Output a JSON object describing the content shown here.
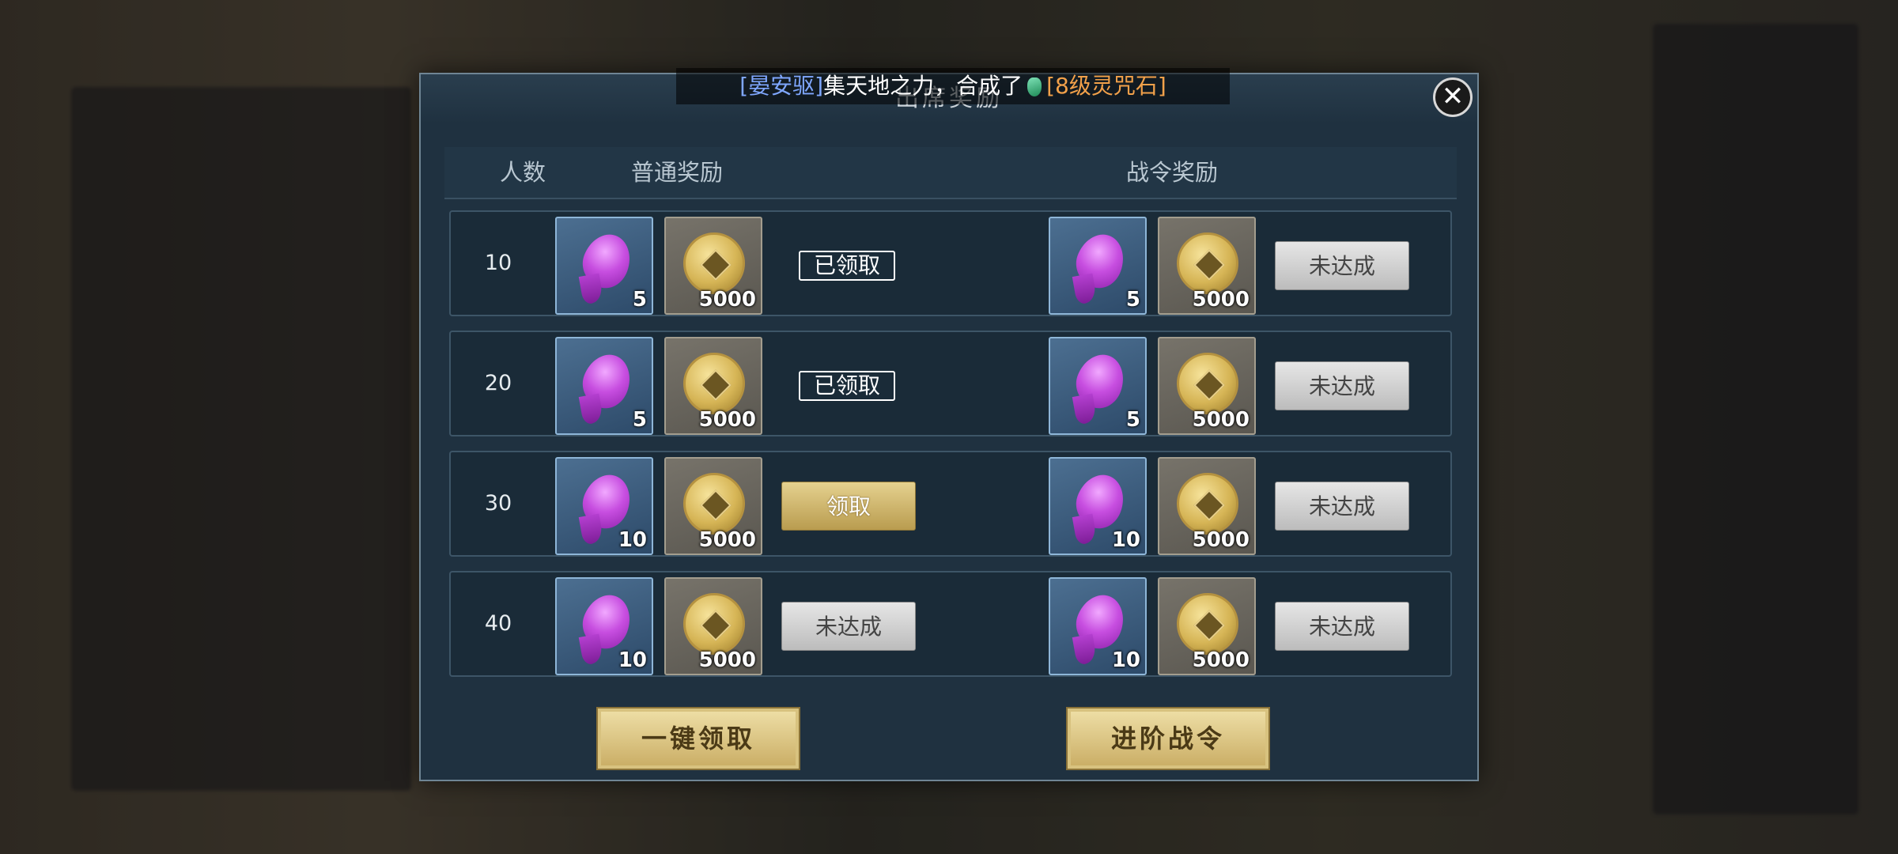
{
  "banner": {
    "player": "[晏安驱]",
    "message": "集天地之力，合成了",
    "item": "[8级灵咒石]"
  },
  "modal": {
    "title": "出席奖励",
    "headers": {
      "count": "人数",
      "normal": "普通奖励",
      "pass": "战令奖励"
    }
  },
  "rows": [
    {
      "count": "10",
      "normal_frag_qty": "5",
      "normal_coin_qty": "5000",
      "normal_status": "已领取",
      "pass_frag_qty": "5",
      "pass_coin_qty": "5000",
      "pass_status": "未达成"
    },
    {
      "count": "20",
      "normal_frag_qty": "5",
      "normal_coin_qty": "5000",
      "normal_status": "已领取",
      "pass_frag_qty": "5",
      "pass_coin_qty": "5000",
      "pass_status": "未达成"
    },
    {
      "count": "30",
      "normal_frag_qty": "10",
      "normal_coin_qty": "5000",
      "normal_status": "领取",
      "pass_frag_qty": "10",
      "pass_coin_qty": "5000",
      "pass_status": "未达成"
    },
    {
      "count": "40",
      "normal_frag_qty": "10",
      "normal_coin_qty": "5000",
      "normal_status": "未达成",
      "pass_frag_qty": "10",
      "pass_coin_qty": "5000",
      "pass_status": "未达成"
    }
  ],
  "buttons": {
    "claim_all": "一键领取",
    "upgrade_pass": "进阶战令"
  },
  "colors": {
    "modal_bg": "#1f3140",
    "gold_button": "#c9ac63",
    "grey_button": "#bcbcbc",
    "player_name": "#7fa7ff",
    "item_name": "#f2a14a"
  }
}
